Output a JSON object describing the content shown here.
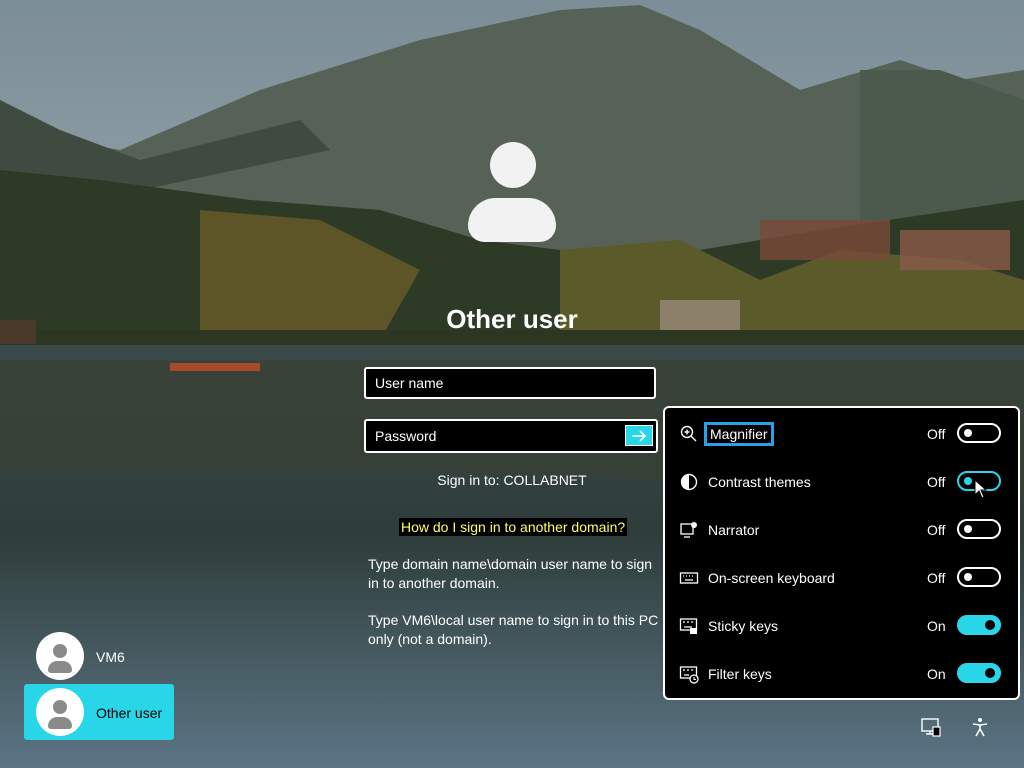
{
  "login": {
    "display_name": "Other user",
    "username_placeholder": "User name",
    "password_placeholder": "Password",
    "sign_in_to": "Sign in to: COLLABNET",
    "help_link": "How do I sign in to another domain?",
    "info_domain": "Type domain name\\domain user name to sign in to another domain.",
    "info_local": "Type VM6\\local user name to sign in to this PC only (not a domain)."
  },
  "accessibility": {
    "items": [
      {
        "icon": "magnifier-icon",
        "label": "Magnifier",
        "state": "Off"
      },
      {
        "icon": "contrast-icon",
        "label": "Contrast themes",
        "state": "Off"
      },
      {
        "icon": "narrator-icon",
        "label": "Narrator",
        "state": "Off"
      },
      {
        "icon": "keyboard-icon",
        "label": "On-screen keyboard",
        "state": "Off"
      },
      {
        "icon": "sticky-keys-icon",
        "label": "Sticky keys",
        "state": "On"
      },
      {
        "icon": "filter-keys-icon",
        "label": "Filter keys",
        "state": "On"
      }
    ]
  },
  "users": [
    {
      "name": "VM6",
      "selected": false
    },
    {
      "name": "Other user",
      "selected": true
    }
  ],
  "colors": {
    "accent": "#29d6e8",
    "link": "#ffff66",
    "panel": "#000000",
    "focus": "#29a3e8"
  },
  "corner_icons": [
    "network-icon",
    "accessibility-icon"
  ]
}
